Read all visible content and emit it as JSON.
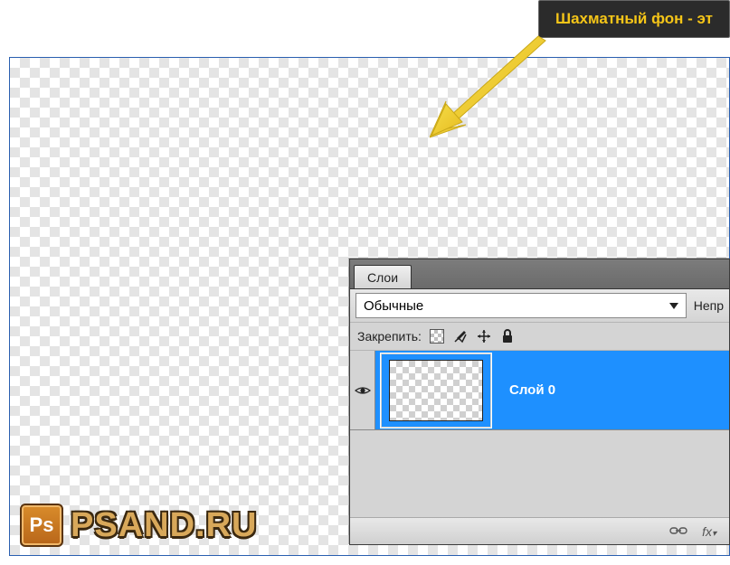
{
  "tooltip": {
    "text": "Шахматный фон - эт"
  },
  "layers_panel": {
    "tab_label": "Слои",
    "blend_mode": "Обычные",
    "opacity_label": "Непр",
    "lock_label": "Закрепить:",
    "layer_name": "Слой 0",
    "footer": {
      "link_icon": "⊂⊃",
      "fx": "fx"
    }
  },
  "watermark": {
    "badge": "Ps",
    "text": "PSAND.RU"
  }
}
